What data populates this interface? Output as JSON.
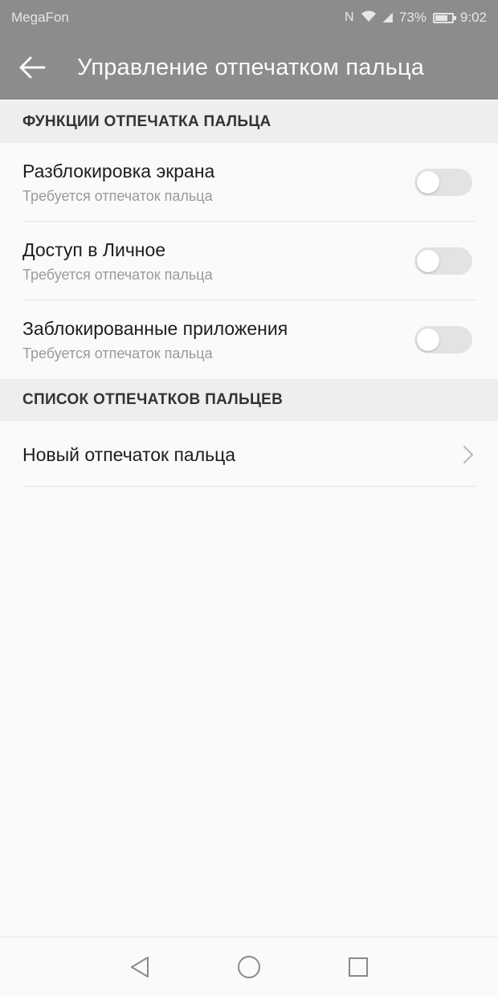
{
  "status_bar": {
    "carrier": "MegaFon",
    "nfc": "N",
    "signal": "◢",
    "battery_percent": "73%",
    "time": "9:02"
  },
  "app_bar": {
    "title": "Управление отпечатком пальца",
    "back_icon": "arrow-back-icon"
  },
  "sections": {
    "functions": {
      "header": "ФУНКЦИИ ОТПЕЧАТКА ПАЛЬЦА",
      "items": [
        {
          "title": "Разблокировка экрана",
          "subtitle": "Требуется отпечаток пальца",
          "enabled": false
        },
        {
          "title": "Доступ в Личное",
          "subtitle": "Требуется отпечаток пальца",
          "enabled": false
        },
        {
          "title": "Заблокированные приложения",
          "subtitle": "Требуется отпечаток пальца",
          "enabled": false
        }
      ]
    },
    "list": {
      "header": "СПИСОК ОТПЕЧАТКОВ ПАЛЬЦЕВ",
      "items": [
        {
          "title": "Новый отпечаток пальца"
        }
      ]
    }
  },
  "nav_bar": {
    "back": "nav-back-icon",
    "home": "nav-home-icon",
    "recents": "nav-recents-icon"
  },
  "colors": {
    "app_bar": "#8c8c8c",
    "background": "#fafafa",
    "section_bg": "#eeeeee",
    "toggle_off": "#e3e3e3"
  }
}
